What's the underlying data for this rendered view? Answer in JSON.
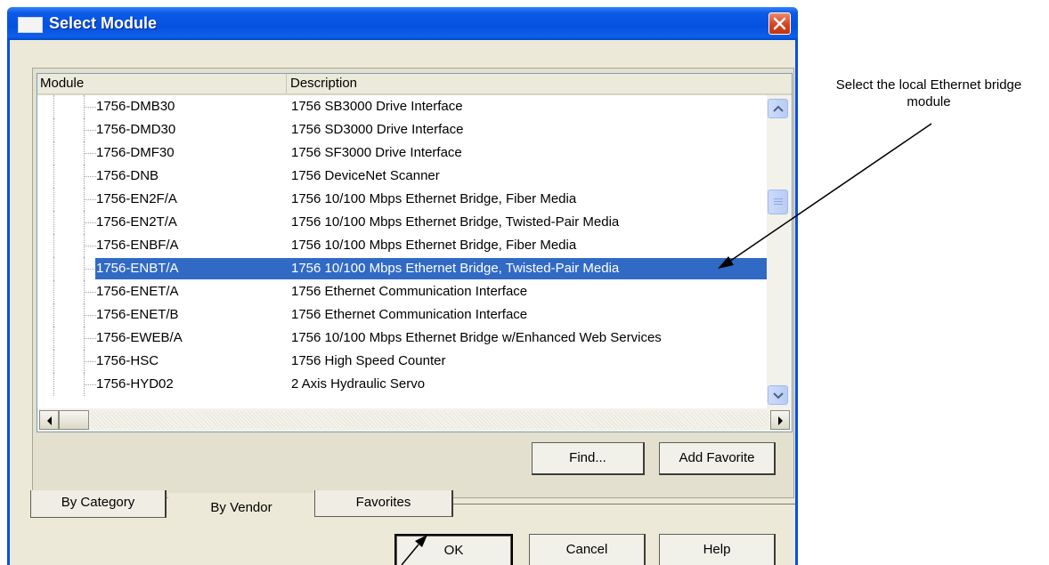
{
  "window": {
    "title": "Select Module"
  },
  "list": {
    "columns": {
      "module": "Module",
      "description": "Description"
    },
    "rows": [
      {
        "module": "1756-DMB30",
        "description": "1756 SB3000 Drive Interface"
      },
      {
        "module": "1756-DMD30",
        "description": "1756 SD3000 Drive Interface"
      },
      {
        "module": "1756-DMF30",
        "description": "1756 SF3000 Drive Interface"
      },
      {
        "module": "1756-DNB",
        "description": "1756 DeviceNet Scanner"
      },
      {
        "module": "1756-EN2F/A",
        "description": "1756 10/100 Mbps Ethernet Bridge, Fiber Media"
      },
      {
        "module": "1756-EN2T/A",
        "description": "1756 10/100 Mbps Ethernet Bridge, Twisted-Pair Media"
      },
      {
        "module": "1756-ENBF/A",
        "description": "1756 10/100 Mbps Ethernet Bridge, Fiber Media"
      },
      {
        "module": "1756-ENBT/A",
        "description": "1756 10/100 Mbps Ethernet Bridge, Twisted-Pair Media",
        "selected": true
      },
      {
        "module": "1756-ENET/A",
        "description": "1756 Ethernet Communication Interface"
      },
      {
        "module": "1756-ENET/B",
        "description": "1756 Ethernet Communication Interface"
      },
      {
        "module": "1756-EWEB/A",
        "description": "1756 10/100 Mbps Ethernet Bridge w/Enhanced Web Services"
      },
      {
        "module": "1756-HSC",
        "description": "1756 High Speed Counter"
      },
      {
        "module": "1756-HYD02",
        "description": "2 Axis Hydraulic Servo"
      }
    ]
  },
  "buttons": {
    "find": "Find...",
    "add_favorite": "Add Favorite",
    "ok": "OK",
    "cancel": "Cancel",
    "help": "Help"
  },
  "tabs": {
    "by_category": "By Category",
    "by_vendor": "By Vendor",
    "favorites": "Favorites"
  },
  "annotation": {
    "text": "Select the local Ethernet bridge module"
  },
  "colors": {
    "titlebar": "#0550e0",
    "selection": "#316ac5",
    "dialog_bg": "#ece9d8"
  }
}
